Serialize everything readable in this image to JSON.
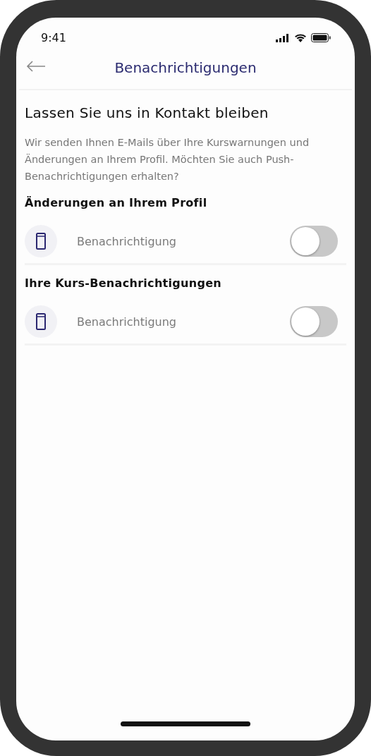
{
  "status_bar": {
    "time": "9:41"
  },
  "header": {
    "title": "Benachrichtigungen"
  },
  "intro": {
    "heading": "Lassen Sie uns in Kontakt bleiben",
    "text": "Wir senden Ihnen E-Mails über Ihre Kurswarnungen und Änderungen an Ihrem Profil. Möchten Sie auch Push-Benachrichtigungen erhalten?"
  },
  "sections": [
    {
      "title": "Änderungen an Ihrem Profil",
      "rows": [
        {
          "label": "Benachrichtigung",
          "on": false
        }
      ]
    },
    {
      "title": "Ihre Kurs-Benachrichtigungen",
      "rows": [
        {
          "label": "Benachrichtigung",
          "on": false
        }
      ]
    }
  ]
}
